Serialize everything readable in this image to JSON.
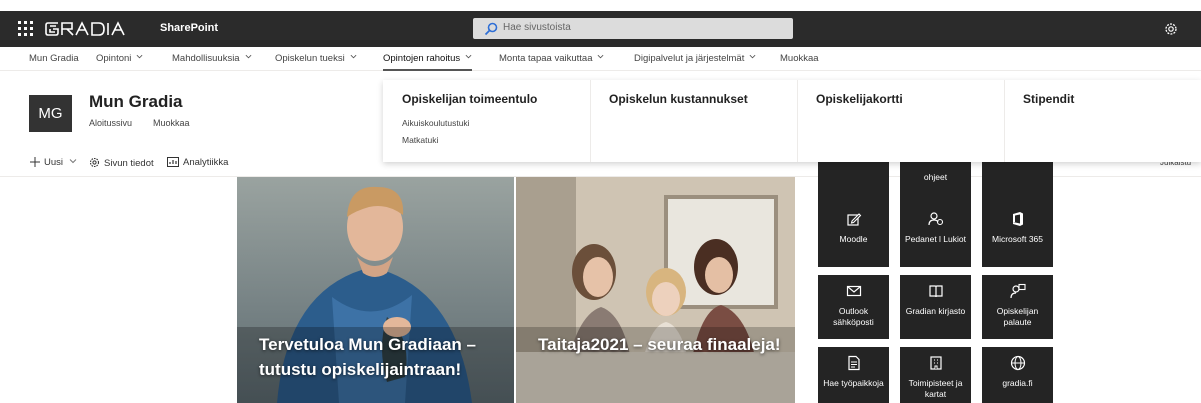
{
  "suite": {
    "brand": "SharePoint",
    "logo_text": "GRADIA",
    "search_placeholder": "Hae sivustoista"
  },
  "topnav": [
    {
      "label": "Mun Gradia",
      "dropdown": false
    },
    {
      "label": "Opintoni",
      "dropdown": true
    },
    {
      "label": "Mahdollisuuksia",
      "dropdown": true
    },
    {
      "label": "Opiskelun tueksi",
      "dropdown": true
    },
    {
      "label": "Opintojen rahoitus",
      "dropdown": true,
      "active": true
    },
    {
      "label": "Monta tapaa vaikuttaa",
      "dropdown": true
    },
    {
      "label": "Digipalvelut ja järjestelmät",
      "dropdown": true
    },
    {
      "label": "Muokkaa",
      "dropdown": false
    }
  ],
  "site": {
    "logo_initials": "MG",
    "title": "Mun Gradia",
    "links": [
      "Aloitussivu",
      "Muokkaa"
    ]
  },
  "commandbar": {
    "new_label": "Uusi",
    "page_details_label": "Sivun tiedot",
    "analytics_label": "Analytiikka",
    "published_label": "Julkaistu"
  },
  "megamenu": [
    {
      "heading": "Opiskelijan toimeentulo",
      "items": [
        "Aikuiskoulutustuki",
        "Matkatuki"
      ]
    },
    {
      "heading": "Opiskelun kustannukset",
      "items": []
    },
    {
      "heading": "Opiskelijakortti",
      "items": []
    },
    {
      "heading": "Stipendit",
      "items": []
    }
  ],
  "hero": [
    {
      "title": "Tervetuloa Mun Gradiaan – tutustu opiskelijaintraan!"
    },
    {
      "title": "Taitaja2021 – seuraa finaaleja!"
    }
  ],
  "quicklinks": {
    "partial_top": [
      "",
      "ohjeet",
      ""
    ],
    "tiles": [
      {
        "label": "Moodle",
        "icon": "edit-icon"
      },
      {
        "label": "Pedanet l Lukiot",
        "icon": "people-icon"
      },
      {
        "label": "Microsoft 365",
        "icon": "office-icon"
      },
      {
        "label": "Outlook sähköposti",
        "icon": "mail-icon"
      },
      {
        "label": "Gradian kirjasto",
        "icon": "book-icon"
      },
      {
        "label": "Opiskelijan palaute",
        "icon": "feedback-icon"
      },
      {
        "label": "Hae työpaikkoja",
        "icon": "document-icon"
      },
      {
        "label": "Toimipisteet ja kartat",
        "icon": "building-icon"
      },
      {
        "label": "gradia.fi",
        "icon": "globe-icon"
      }
    ]
  },
  "colors": {
    "suitebar": "#2b2b2b",
    "tile": "#242424",
    "text": "#323130"
  }
}
